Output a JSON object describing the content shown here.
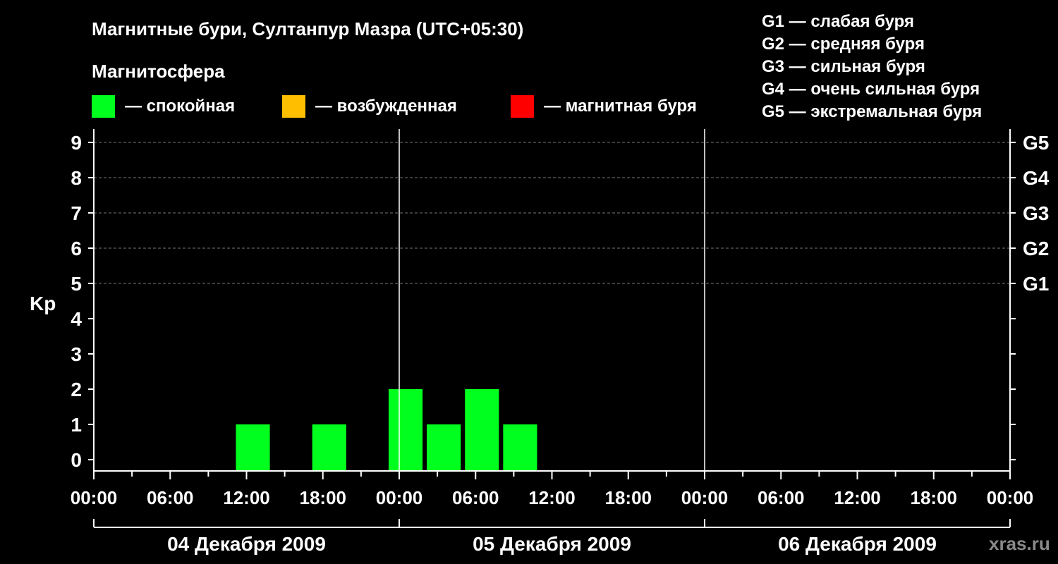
{
  "chart_data": {
    "type": "bar",
    "title": "Магнитные бури, Султанпур Мазра (UTC+05:30)",
    "legend_title": "Магнитосфера",
    "legend": [
      {
        "name": "— спокойная",
        "color": "#00ff1e"
      },
      {
        "name": "— возбужденная",
        "color": "#ffbe00"
      },
      {
        "name": "— магнитная буря",
        "color": "#ff0000"
      }
    ],
    "storm_scale": [
      "G1 — слабая буря",
      "G2 — средняя буря",
      "G3 — сильная буря",
      "G4 — очень сильная буря",
      "G5 — экстремальная буря"
    ],
    "ylabel": "Kp",
    "ylim": [
      0,
      9
    ],
    "y_ticks": [
      "0",
      "1",
      "2",
      "3",
      "4",
      "5",
      "6",
      "7",
      "8",
      "9"
    ],
    "right_ticks": [
      {
        "kp": 5,
        "label": "G1"
      },
      {
        "kp": 6,
        "label": "G2"
      },
      {
        "kp": 7,
        "label": "G3"
      },
      {
        "kp": 8,
        "label": "G4"
      },
      {
        "kp": 9,
        "label": "G5"
      }
    ],
    "grid": true,
    "x_ticks": [
      "00:00",
      "06:00",
      "12:00",
      "18:00",
      "00:00",
      "06:00",
      "12:00",
      "18:00",
      "00:00",
      "06:00",
      "12:00",
      "18:00",
      "00:00"
    ],
    "days": [
      "04 Декабря 2009",
      "05 Декабря 2009",
      "06 Декабря 2009"
    ],
    "bars": [
      {
        "start": "04 Декабря 2009 11:00",
        "end": "04 Декабря 2009 14:00",
        "kp": 1,
        "color": "#00ff1e"
      },
      {
        "start": "04 Декабря 2009 17:00",
        "end": "04 Декабря 2009 20:00",
        "kp": 1,
        "color": "#00ff1e"
      },
      {
        "start": "04 Декабря 2009 23:00",
        "end": "05 Декабря 2009 02:00",
        "kp": 2,
        "color": "#00ff1e"
      },
      {
        "start": "05 Декабря 2009 02:00",
        "end": "05 Декабря 2009 05:00",
        "kp": 1,
        "color": "#00ff1e"
      },
      {
        "start": "05 Декабря 2009 05:00",
        "end": "05 Декабря 2009 08:00",
        "kp": 2,
        "color": "#00ff1e"
      },
      {
        "start": "05 Декабря 2009 08:00",
        "end": "05 Декабря 2009 11:00",
        "kp": 1,
        "color": "#00ff1e"
      }
    ]
  },
  "watermark": "xras.ru"
}
